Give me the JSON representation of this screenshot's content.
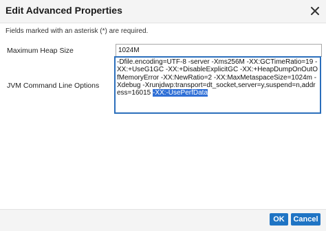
{
  "dialog": {
    "title": "Edit Advanced Properties",
    "required_note": "Fields marked with an asterisk (*) are required."
  },
  "fields": {
    "max_heap": {
      "label": "Maximum Heap Size",
      "value": "1024M"
    },
    "jvm_options": {
      "label": "JVM Command Line Options",
      "value_unselected": "-Dfile.encoding=UTF-8 -server -Xms256M -XX:GCTimeRatio=19 -XX:+UseG1GC -XX:+DisableExplicitGC -XX:+HeapDumpOnOutOfMemoryError -XX:NewRatio=2 -XX:MaxMetaspaceSize=1024m -Xdebug -Xrunjdwp:transport=dt_socket,server=y,suspend=n,address=16015 ",
      "value_selected": "-XX:-UsePerfData"
    }
  },
  "buttons": {
    "ok": "OK",
    "cancel": "Cancel"
  },
  "icons": {
    "close": "close-icon"
  },
  "colors": {
    "primary_button": "#1f74c4",
    "focus_border": "#2a6ebb",
    "selection": "#2f6fd6"
  }
}
